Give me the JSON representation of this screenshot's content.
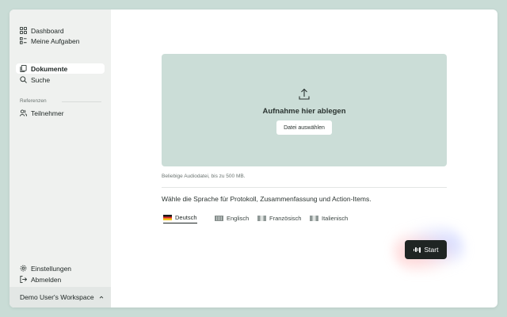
{
  "sidebar": {
    "items": [
      {
        "label": "Dashboard",
        "icon": "dashboard-icon"
      },
      {
        "label": "Meine Aufgaben",
        "icon": "tasks-icon"
      },
      {
        "label": "Dokumente",
        "icon": "documents-icon",
        "active": true
      },
      {
        "label": "Suche",
        "icon": "search-icon"
      }
    ],
    "section_label": "Referenzen",
    "reference_items": [
      {
        "label": "Teilnehmer",
        "icon": "users-icon"
      }
    ],
    "bottom_items": [
      {
        "label": "Einstellungen",
        "icon": "gear-icon"
      },
      {
        "label": "Abmelden",
        "icon": "logout-icon"
      }
    ],
    "workspace": "Demo User's Workspace"
  },
  "upload": {
    "title": "Aufnahme hier ablegen",
    "button_label": "Datei auswählen",
    "hint": "Beliebige Audiodatei, bis zu 500 MB."
  },
  "language": {
    "question": "Wähle die Sprache für Protokoll, Zusammenfassung und Action-Items.",
    "options": [
      {
        "label": "Deutsch",
        "selected": true
      },
      {
        "label": "Englisch",
        "selected": false
      },
      {
        "label": "Französisch",
        "selected": false
      },
      {
        "label": "Italienisch",
        "selected": false
      }
    ]
  },
  "start": {
    "label": "Start"
  },
  "colors": {
    "background": "#c9dcd6",
    "dropzone": "#cbddd7",
    "sidebar": "#eff1ef",
    "button_dark": "#1f2523"
  }
}
